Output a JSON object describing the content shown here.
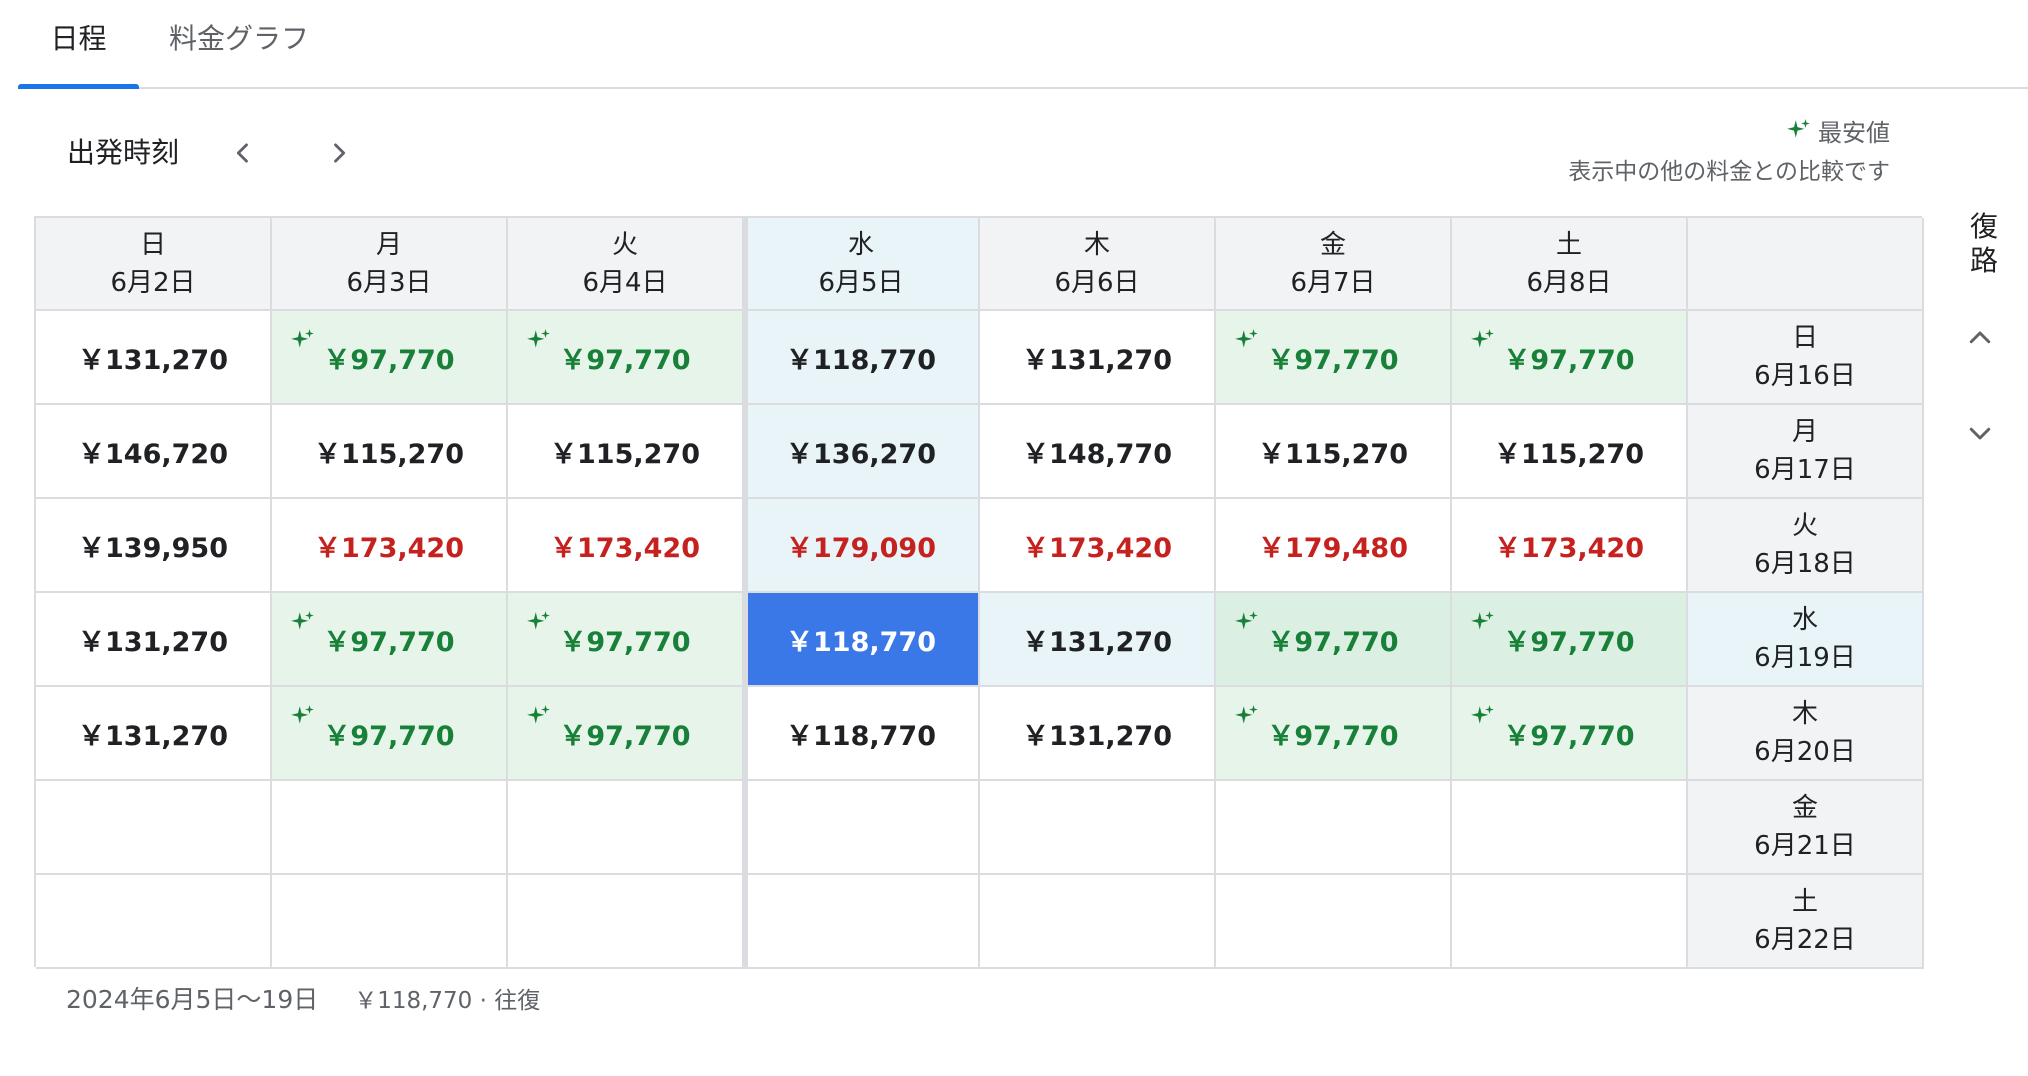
{
  "tabs": [
    {
      "label": "日程",
      "active": true
    },
    {
      "label": "料金グラフ",
      "active": false
    }
  ],
  "toolbar": {
    "departure_label": "出発時刻",
    "prev_icon": "chevron-left-icon",
    "next_icon": "chevron-right-icon"
  },
  "legend": {
    "icon": "sparkle-icon",
    "cheapest_label": "最安値",
    "note": "表示中の他の料金との比較です"
  },
  "return_label": "復路",
  "columns": [
    {
      "dow": "日",
      "date": "6月2日"
    },
    {
      "dow": "月",
      "date": "6月3日"
    },
    {
      "dow": "火",
      "date": "6月4日"
    },
    {
      "dow": "水",
      "date": "6月5日"
    },
    {
      "dow": "木",
      "date": "6月6日"
    },
    {
      "dow": "金",
      "date": "6月7日"
    },
    {
      "dow": "土",
      "date": "6月8日"
    }
  ],
  "rows": [
    {
      "dow": "日",
      "date": "6月16日",
      "prices": [
        "￥131,270",
        "￥97,770",
        "￥97,770",
        "￥118,770",
        "￥131,270",
        "￥97,770",
        "￥97,770"
      ]
    },
    {
      "dow": "月",
      "date": "6月17日",
      "prices": [
        "￥146,720",
        "￥115,270",
        "￥115,270",
        "￥136,270",
        "￥148,770",
        "￥115,270",
        "￥115,270"
      ]
    },
    {
      "dow": "火",
      "date": "6月18日",
      "prices": [
        "￥139,950",
        "￥173,420",
        "￥173,420",
        "￥179,090",
        "￥173,420",
        "￥179,480",
        "￥173,420"
      ]
    },
    {
      "dow": "水",
      "date": "6月19日",
      "prices": [
        "￥131,270",
        "￥97,770",
        "￥97,770",
        "￥118,770",
        "￥131,270",
        "￥97,770",
        "￥97,770"
      ]
    },
    {
      "dow": "木",
      "date": "6月20日",
      "prices": [
        "￥131,270",
        "￥97,770",
        "￥97,770",
        "￥118,770",
        "￥131,270",
        "￥97,770",
        "￥97,770"
      ]
    },
    {
      "dow": "金",
      "date": "6月21日",
      "prices": [
        "",
        "",
        "",
        "",
        "",
        "",
        ""
      ]
    },
    {
      "dow": "土",
      "date": "6月22日",
      "prices": [
        "",
        "",
        "",
        "",
        "",
        "",
        ""
      ]
    }
  ],
  "cell_status": [
    [
      "normal",
      "cheap",
      "cheap",
      "normal",
      "normal",
      "cheap",
      "cheap"
    ],
    [
      "normal",
      "normal",
      "normal",
      "normal",
      "normal",
      "normal",
      "normal"
    ],
    [
      "normal",
      "high",
      "high",
      "high",
      "high",
      "high",
      "high"
    ],
    [
      "normal",
      "cheap",
      "cheap",
      "selected",
      "normal",
      "cheap",
      "cheap"
    ],
    [
      "normal",
      "cheap",
      "cheap",
      "normal",
      "normal",
      "cheap",
      "cheap"
    ],
    [
      "empty",
      "empty",
      "empty",
      "empty",
      "empty",
      "empty",
      "empty"
    ],
    [
      "empty",
      "empty",
      "empty",
      "empty",
      "empty",
      "empty",
      "empty"
    ]
  ],
  "selected": {
    "column_index": 3,
    "row_index": 3
  },
  "footer": {
    "dates": "2024年6月5日〜19日",
    "summary": "￥118,770 · 往復"
  },
  "colors": {
    "accent": "#1a73e8",
    "selected_bg": "#3b78e7",
    "cheap_text": "#188038",
    "cheap_bg": "#e6f4ea",
    "high_text": "#c5221f",
    "highlight_bg": "#e8f4f8"
  }
}
